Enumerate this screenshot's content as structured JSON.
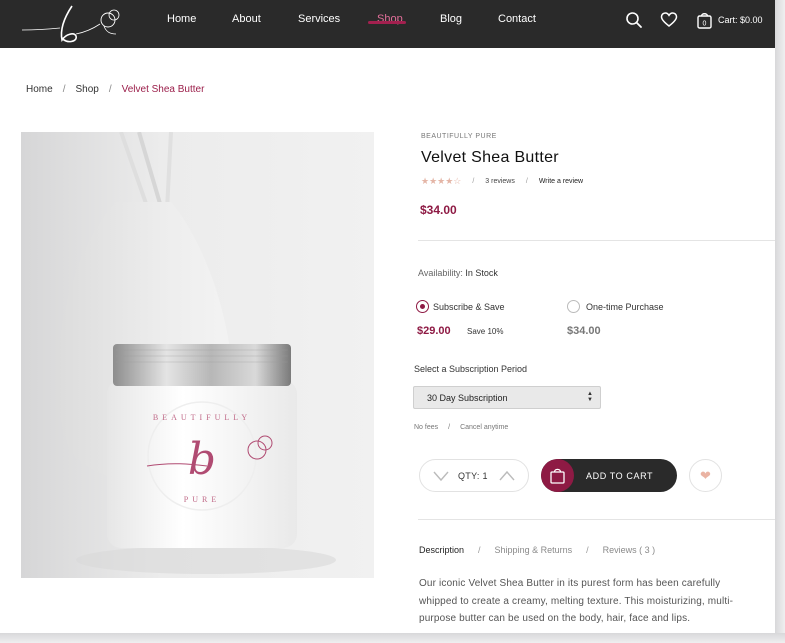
{
  "header": {
    "nav": [
      {
        "label": "Home",
        "active": false
      },
      {
        "label": "About",
        "active": false
      },
      {
        "label": "Services",
        "active": false
      },
      {
        "label": "Shop",
        "active": true
      },
      {
        "label": "Blog",
        "active": false
      },
      {
        "label": "Contact",
        "active": false
      }
    ],
    "cart_count": "0",
    "cart_label": "Cart: $0.00"
  },
  "breadcrumb": [
    "Home",
    "Shop",
    "Velvet Shea Butter"
  ],
  "breadcrumb_sep": "/",
  "product": {
    "brand": "BEAUTIFULLY PURE",
    "title": "Velvet Shea Butter",
    "rating": 4,
    "rating_max": 5,
    "reviews": "3 reviews",
    "write_review": "Write a review",
    "price": "$34.00",
    "availability_label": "Availability:",
    "availability_value": "In Stock",
    "jar_brand_top": "BEAUTIFULLY",
    "jar_letter": "b",
    "jar_brand_bottom": "PURE"
  },
  "purchase": {
    "subscribe_label": "Subscribe & Save",
    "subscribe_price": "$29.00",
    "subscribe_save": "Save 10%",
    "onetime_label": "One-time Purchase",
    "onetime_price": "$34.00",
    "selected": "subscribe",
    "period_label": "Select a Subscription Period",
    "period_value": "30 Day Subscription",
    "no_fees": "No fees",
    "cancel_anytime": "Cancel anytime",
    "qty_label": "QTY:",
    "qty_value": "1",
    "add_to_cart": "ADD TO CART"
  },
  "tabs": [
    {
      "label": "Description",
      "active": true
    },
    {
      "label": "Shipping & Returns",
      "active": false
    },
    {
      "label": "Reviews ( 3 )",
      "active": false
    }
  ],
  "description": "Our iconic Velvet Shea Butter in its purest form has been carefully whipped to create a creamy, melting texture. This moisturizing, multi-purpose butter can be used on the body, hair, face and lips.",
  "colors": {
    "header_bg": "#2a2a2a",
    "accent": "#8e1a44",
    "star": "#e4b5a6"
  }
}
